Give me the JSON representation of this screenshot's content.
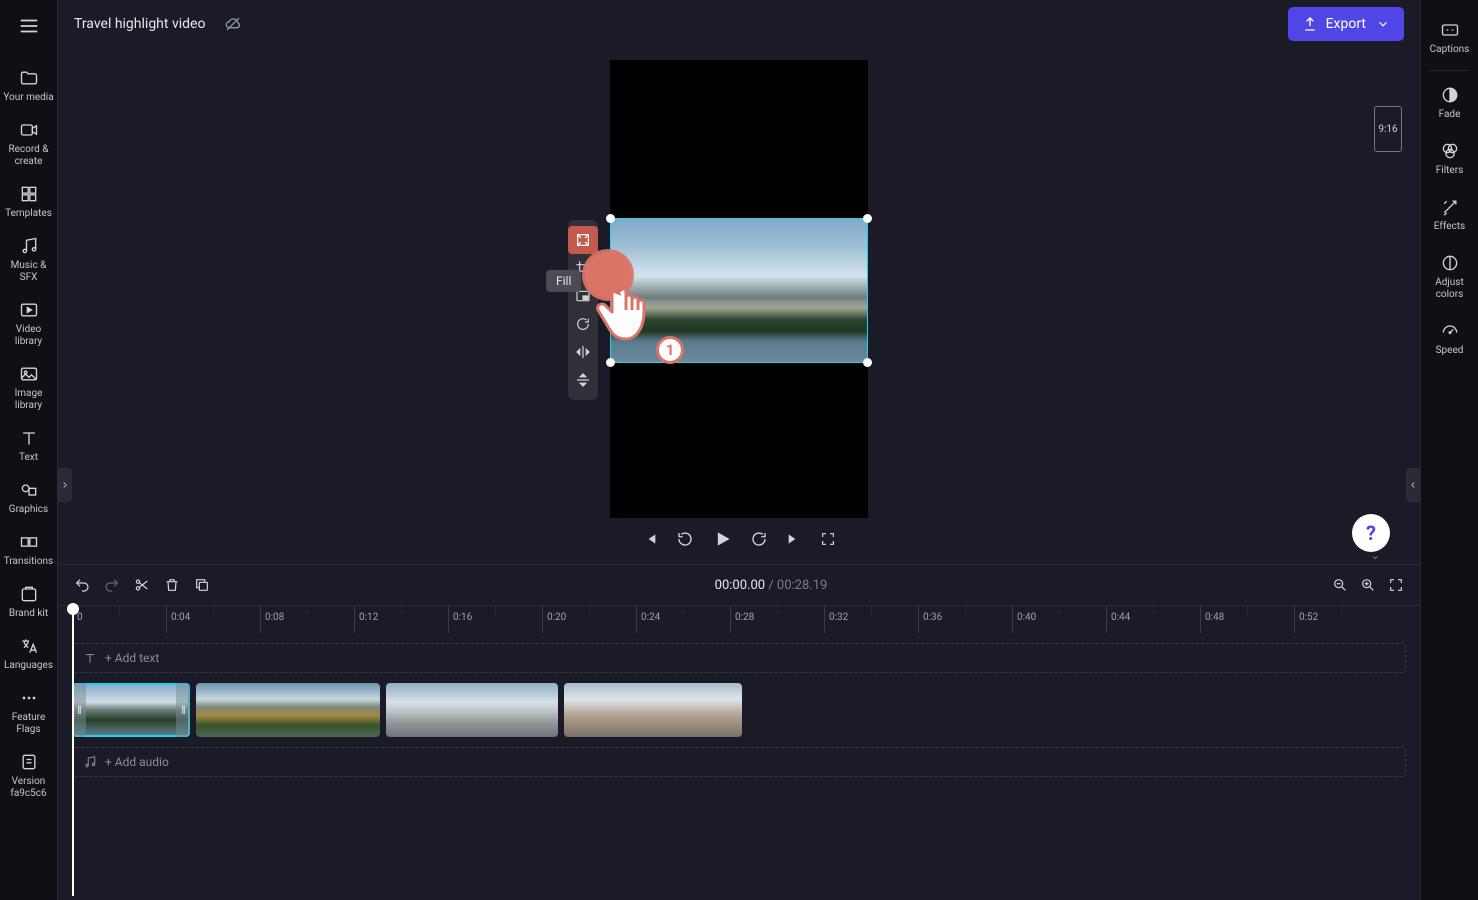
{
  "project": {
    "name": "Travel highlight video"
  },
  "header": {
    "export_label": "Export",
    "aspect_label": "9:16"
  },
  "left_sidebar": {
    "items": [
      {
        "label": "Your media"
      },
      {
        "label": "Record & create"
      },
      {
        "label": "Templates"
      },
      {
        "label": "Music & SFX"
      },
      {
        "label": "Video library"
      },
      {
        "label": "Image library"
      },
      {
        "label": "Text"
      },
      {
        "label": "Graphics"
      },
      {
        "label": "Transitions"
      },
      {
        "label": "Brand kit"
      },
      {
        "label": "Languages"
      },
      {
        "label": "Feature Flags"
      },
      {
        "label": "Version fa9c5c6"
      }
    ]
  },
  "right_sidebar": {
    "items": [
      {
        "label": "Captions"
      },
      {
        "label": "Fade"
      },
      {
        "label": "Filters"
      },
      {
        "label": "Effects"
      },
      {
        "label": "Adjust colors"
      },
      {
        "label": "Speed"
      }
    ]
  },
  "canvas_toolbar": {
    "fill_tooltip": "Fill"
  },
  "callout": {
    "badge": "1"
  },
  "timeline": {
    "current": "00:00.00",
    "sep": " / ",
    "total": "00:28.19",
    "add_text_label": "+ Add text",
    "add_audio_label": "+ Add audio",
    "ticks": [
      "0",
      "0:04",
      "0:08",
      "0:12",
      "0:16",
      "0:20",
      "0:24",
      "0:28",
      "0:32",
      "0:36",
      "0:40",
      "0:44",
      "0:48",
      "0:52"
    ]
  }
}
